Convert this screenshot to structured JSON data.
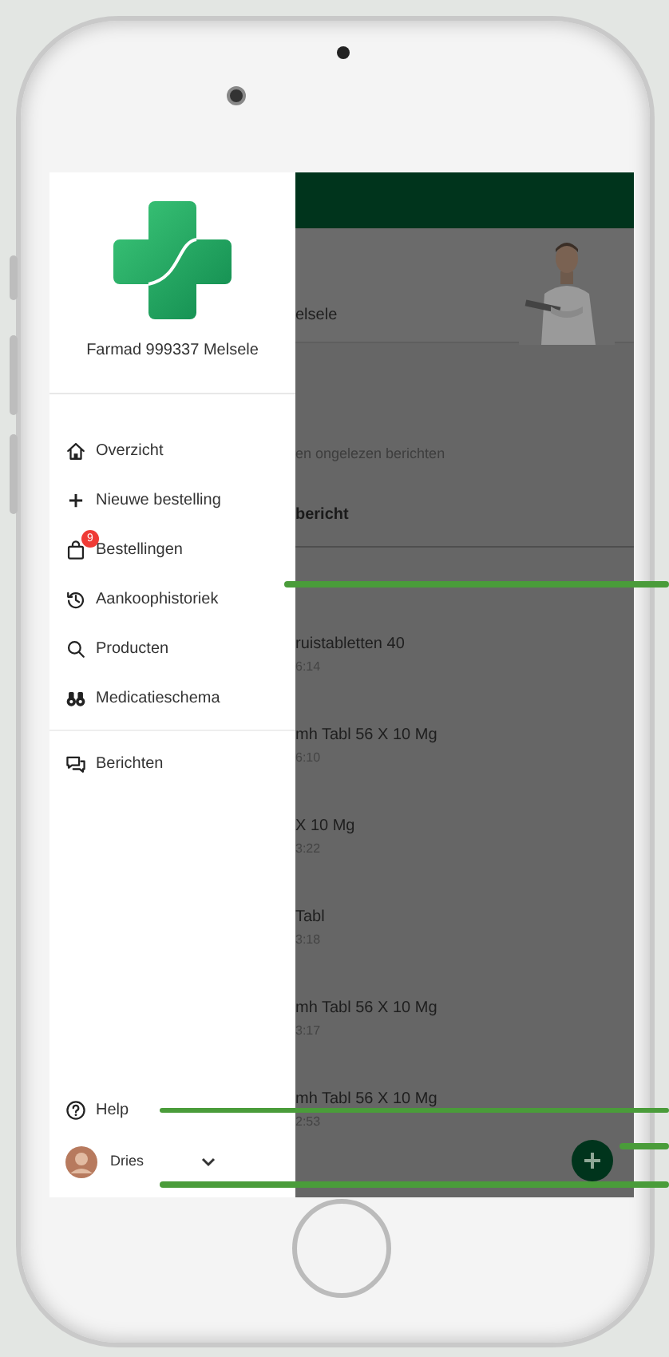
{
  "drawer": {
    "pharmacy_name": "Farmad 999337 Melsele",
    "menu": [
      {
        "kind": "home",
        "label": "Overzicht"
      },
      {
        "kind": "plus",
        "label": "Nieuwe bestelling"
      },
      {
        "kind": "bag",
        "label": "Bestellingen",
        "badge": "9"
      },
      {
        "kind": "history",
        "label": "Aankoophistoriek"
      },
      {
        "kind": "search",
        "label": "Producten"
      },
      {
        "kind": "binoculars",
        "label": "Medicatieschema"
      }
    ],
    "secondary_menu": [
      {
        "kind": "chat",
        "label": "Berichten"
      }
    ],
    "help": {
      "label": "Help"
    },
    "user": {
      "name": "Dries"
    }
  },
  "main": {
    "card_text": "elsele",
    "unread_text": "en ongelezen berichten",
    "tab": "bericht",
    "messages": [
      {
        "title": "ruistabletten 40",
        "time": "6:14"
      },
      {
        "title": "mh Tabl 56 X 10 Mg",
        "time": "6:10"
      },
      {
        "title": "X 10 Mg",
        "time": "3:22"
      },
      {
        "title": "Tabl",
        "time": "3:18"
      },
      {
        "title": "mh Tabl 56 X 10 Mg",
        "time": "3:17"
      },
      {
        "title": "mh Tabl 56 X 10 Mg",
        "time": "2:53"
      }
    ]
  }
}
